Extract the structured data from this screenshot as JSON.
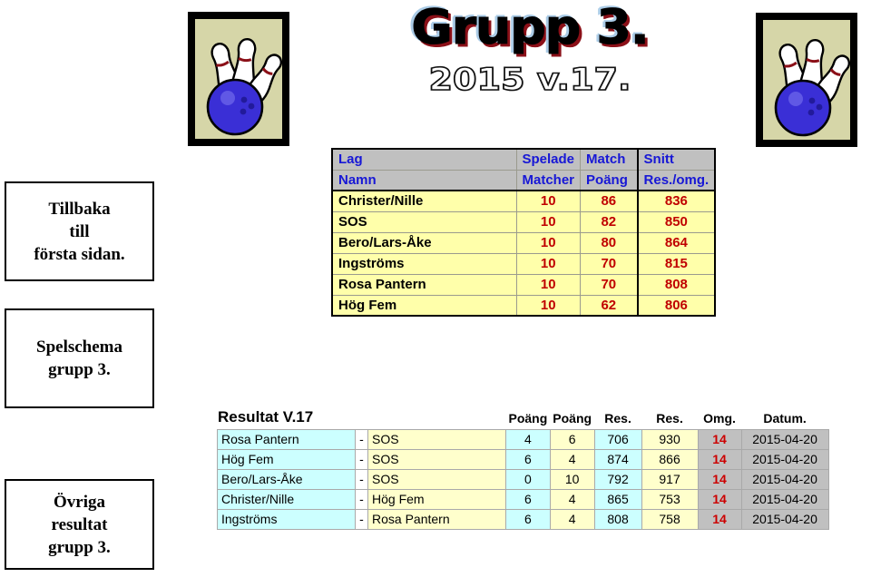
{
  "header": {
    "title_main": "Grupp 3.",
    "title_sub": "2015 v.17.",
    "clipart_left": "bowling-pins-and-ball-icon",
    "clipart_right": "bowling-pins-and-ball-icon"
  },
  "sidebar": {
    "items": [
      {
        "name": "back-to-first-page",
        "lines": [
          "Tillbaka",
          "till",
          "första sidan."
        ]
      },
      {
        "name": "schedule-group-3",
        "lines": [
          "Spelschema",
          "grupp 3."
        ]
      },
      {
        "name": "other-results-group-3",
        "lines": [
          "Övriga",
          "resultat",
          "grupp 3."
        ]
      }
    ]
  },
  "standings": {
    "headers_row1": [
      "Lag",
      "Spelade",
      "Match",
      "Snitt"
    ],
    "headers_row2": [
      "Namn",
      "Matcher",
      "Poäng",
      "Res./omg."
    ],
    "rows": [
      {
        "team": "Christer/Nille",
        "played": "10",
        "points": "86",
        "average": "836"
      },
      {
        "team": "SOS",
        "played": "10",
        "points": "82",
        "average": "850"
      },
      {
        "team": "Bero/Lars-Åke",
        "played": "10",
        "points": "80",
        "average": "864"
      },
      {
        "team": "Ingströms",
        "played": "10",
        "points": "70",
        "average": "815"
      },
      {
        "team": "Rosa Pantern",
        "played": "10",
        "points": "70",
        "average": "808"
      },
      {
        "team": "Hög Fem",
        "played": "10",
        "points": "62",
        "average": "806"
      }
    ]
  },
  "results": {
    "title": "Resultat V.17",
    "headers": [
      "",
      "",
      "",
      "Poäng",
      "Poäng",
      "Res.",
      "Res.",
      "Omg.",
      "Datum."
    ],
    "separator": "-",
    "rows": [
      {
        "home": "Rosa Pantern",
        "away": "SOS",
        "home_points": "4",
        "away_points": "6",
        "home_result": "706",
        "away_result": "930",
        "round": "14",
        "date": "2015-04-20"
      },
      {
        "home": "Hög Fem",
        "away": "SOS",
        "home_points": "6",
        "away_points": "4",
        "home_result": "874",
        "away_result": "866",
        "round": "14",
        "date": "2015-04-20"
      },
      {
        "home": "Bero/Lars-Åke",
        "away": "SOS",
        "home_points": "0",
        "away_points": "10",
        "home_result": "792",
        "away_result": "917",
        "round": "14",
        "date": "2015-04-20"
      },
      {
        "home": "Christer/Nille",
        "away": "Hög Fem",
        "home_points": "6",
        "away_points": "4",
        "home_result": "865",
        "away_result": "753",
        "round": "14",
        "date": "2015-04-20"
      },
      {
        "home": "Ingströms",
        "away": "Rosa Pantern",
        "home_points": "6",
        "away_points": "4",
        "home_result": "808",
        "away_result": "758",
        "round": "14",
        "date": "2015-04-20"
      }
    ]
  },
  "colors": {
    "header_gray": "#c0c0c0",
    "header_blue_text": "#1717d6",
    "standings_cell_yellow": "#ffffaa",
    "standings_number_red": "#c00000",
    "results_cyan": "#ccffff",
    "results_yellow": "#ffffcc",
    "results_round_red": "#cc0000"
  }
}
